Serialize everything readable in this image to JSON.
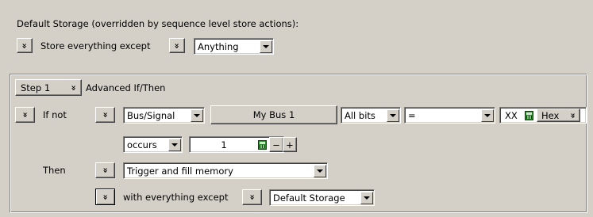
{
  "default_storage": {
    "heading": "Default Storage (overridden by sequence level store actions):",
    "label": "Store everything except",
    "value": "Anything"
  },
  "step": {
    "step_label": "Step 1",
    "title": "Advanced If/Then"
  },
  "condition": {
    "if_label": "If not",
    "source": "Bus/Signal",
    "bus_name": "My Bus 1",
    "bits": "All bits",
    "operator": "=",
    "value": "XX",
    "radix": "Hex",
    "occurs": "occurs",
    "count": "1",
    "minus": "−",
    "plus": "+"
  },
  "action": {
    "then_label": "Then",
    "action": "Trigger and fill memory",
    "with_label": "with everything except",
    "storage": "Default Storage"
  },
  "icons": [
    "chevron-down-icon",
    "calculator-icon",
    "dropdown-arrow-icon"
  ]
}
